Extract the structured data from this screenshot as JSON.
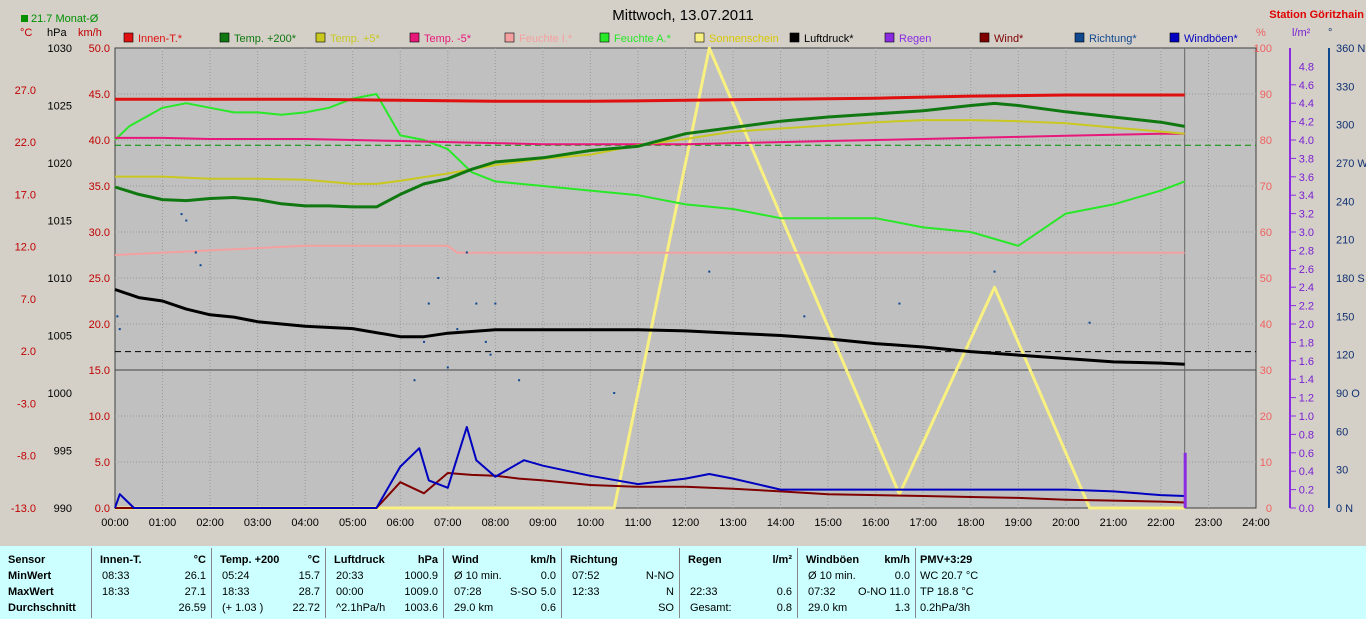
{
  "header": {
    "title": "Mittwoch, 13.07.2011",
    "station": "Station Göritzhain",
    "month_avg": "21.7 Monat-Ø",
    "unit_c": "°C",
    "unit_hpa": "hPa",
    "unit_kmh": "km/h",
    "unit_pct": "%",
    "unit_lm2": "l/m²",
    "unit_deg": "°"
  },
  "colors": {
    "innen": "#e01010",
    "t200": "#107810",
    "t5": "#c8c820",
    "tm5": "#e8187a",
    "feuchte_i": "#f4a0a0",
    "feuchte_a": "#28e828",
    "sonne": "#f8f080",
    "luftdruck": "#000000",
    "regen": "#8a2be2",
    "wind": "#800000",
    "richtung": "#104890",
    "windboeen": "#0000c0",
    "grid": "#999999"
  },
  "chart_data": {
    "type": "line",
    "x_range": [
      "00:00",
      "24:00"
    ],
    "x_ticks": [
      "00:00",
      "01:00",
      "02:00",
      "03:00",
      "04:00",
      "05:00",
      "06:00",
      "07:00",
      "08:00",
      "09:00",
      "10:00",
      "11:00",
      "12:00",
      "13:00",
      "14:00",
      "15:00",
      "16:00",
      "17:00",
      "18:00",
      "19:00",
      "20:00",
      "21:00",
      "22:00",
      "23:00",
      "24:00"
    ],
    "axes": {
      "temp_c": {
        "label": "°C",
        "ticks": [
          "27.0",
          "22.0",
          "17.0",
          "12.0",
          "7.0",
          "2.0",
          "-3.0",
          "-8.0",
          "-13.0"
        ],
        "range": [
          -13,
          31
        ]
      },
      "pressure_hpa": {
        "label": "hPa",
        "ticks": [
          "1030",
          "1025",
          "1020",
          "1015",
          "1010",
          "1005",
          "1000",
          "995",
          "990"
        ],
        "range": [
          990,
          1030
        ]
      },
      "speed_kmh": {
        "label": "km/h",
        "ticks": [
          "50.0",
          "45.0",
          "40.0",
          "35.0",
          "30.0",
          "25.0",
          "20.0",
          "15.0",
          "10.0",
          "5.0",
          "0.0"
        ],
        "range": [
          0,
          50
        ]
      },
      "humidity_pct": {
        "label": "%",
        "ticks": [
          "100",
          "90",
          "80",
          "70",
          "60",
          "50",
          "40",
          "30",
          "20",
          "10",
          "0"
        ],
        "range": [
          0,
          100
        ]
      },
      "rain_lm2": {
        "label": "l/m²",
        "ticks": [
          "4.8",
          "4.6",
          "4.4",
          "4.2",
          "4.0",
          "3.8",
          "3.6",
          "3.4",
          "3.2",
          "3.0",
          "2.8",
          "2.6",
          "2.4",
          "2.2",
          "2.0",
          "1.8",
          "1.6",
          "1.4",
          "1.2",
          "1.0",
          "0.8",
          "0.6",
          "0.4",
          "0.2",
          "0.0"
        ],
        "range": [
          0,
          5.0
        ]
      },
      "direction_deg": {
        "label": "°",
        "ticks": [
          "360 N",
          "330",
          "300",
          "270 W",
          "240",
          "210",
          "180 S",
          "150",
          "120",
          "90 O",
          "60",
          "30",
          "0 N"
        ],
        "range": [
          0,
          360
        ]
      }
    },
    "legend": [
      "Innen-T.*",
      "Temp. +200*",
      "Temp. +5*",
      "Temp. -5*",
      "Feuchte I.*",
      "Feuchte A.*",
      "Sonnenschein",
      "Luftdruck*",
      "Regen",
      "Wind*",
      "Richtung*",
      "Windböen*"
    ],
    "series": [
      {
        "name": "Innen-T.*",
        "axis": "temp_c",
        "x": [
          0,
          2,
          4,
          6,
          8,
          10,
          12,
          14,
          16,
          18,
          20,
          22.5
        ],
        "y": [
          26.1,
          26.1,
          26.1,
          26.0,
          25.9,
          25.9,
          26.0,
          26.1,
          26.2,
          26.4,
          26.5,
          26.5
        ]
      },
      {
        "name": "Temp. +200*",
        "axis": "temp_c",
        "x": [
          0,
          0.5,
          1,
          1.5,
          2,
          2.5,
          3,
          3.5,
          4,
          4.5,
          5,
          5.5,
          6,
          6.5,
          7,
          7.5,
          8,
          9,
          10,
          11,
          12,
          13,
          14,
          15,
          16,
          17,
          18,
          18.5,
          19,
          20,
          21,
          22,
          22.5
        ],
        "y": [
          17.7,
          17.0,
          16.5,
          16.4,
          16.6,
          16.7,
          16.5,
          16.1,
          15.9,
          15.9,
          15.8,
          15.8,
          17.0,
          18.0,
          18.5,
          19.4,
          20.1,
          20.5,
          21.2,
          21.6,
          22.8,
          23.4,
          24.0,
          24.4,
          24.7,
          25.0,
          25.5,
          25.7,
          25.5,
          24.9,
          24.4,
          23.9,
          23.5
        ]
      },
      {
        "name": "Temp. +5*",
        "axis": "temp_c",
        "x": [
          0,
          1,
          2,
          3,
          4,
          5,
          5.5,
          6,
          7,
          8,
          9,
          10,
          11,
          12,
          13,
          14,
          15,
          16,
          17,
          18,
          19,
          20,
          21,
          22,
          22.5
        ],
        "y": [
          18.7,
          18.7,
          18.5,
          18.5,
          18.4,
          18.0,
          18.0,
          18.3,
          19.0,
          19.8,
          20.4,
          20.8,
          21.7,
          22.3,
          23.0,
          23.3,
          23.6,
          23.9,
          24.1,
          24.1,
          24.0,
          23.8,
          23.4,
          23.0,
          22.8
        ]
      },
      {
        "name": "Temp. -5*",
        "axis": "temp_c",
        "x": [
          0,
          1,
          2,
          3,
          4,
          5,
          6,
          7,
          8,
          9,
          10,
          11,
          12,
          13,
          14,
          15,
          16,
          17,
          18,
          19,
          20,
          21,
          22,
          22.5
        ],
        "y": [
          22.4,
          22.4,
          22.3,
          22.3,
          22.3,
          22.2,
          22.1,
          22.0,
          21.9,
          21.8,
          21.8,
          21.8,
          21.8,
          21.9,
          22.0,
          22.1,
          22.2,
          22.3,
          22.4,
          22.5,
          22.6,
          22.7,
          22.8,
          22.8
        ]
      },
      {
        "name": "Feuchte I.*",
        "axis": "humidity_pct",
        "x": [
          0,
          2,
          4,
          5,
          6,
          7,
          7.2,
          8,
          10,
          12,
          14,
          16,
          18,
          20,
          22.5
        ],
        "y": [
          55,
          56,
          57,
          57,
          57,
          57,
          55.5,
          55.5,
          55.5,
          55.5,
          55.5,
          55.5,
          55.5,
          55.5,
          55.5
        ]
      },
      {
        "name": "Feuchte A.*",
        "axis": "humidity_pct",
        "x": [
          0,
          0.3,
          1,
          1.5,
          2,
          2.5,
          3,
          3.5,
          4,
          4.5,
          5,
          5.5,
          6,
          6.5,
          7,
          7.5,
          8,
          9,
          10,
          11,
          12,
          13,
          14,
          15,
          16,
          17,
          18,
          19,
          20,
          21,
          22,
          22.5
        ],
        "y": [
          80,
          83,
          87,
          88,
          87,
          86,
          86,
          85.5,
          86,
          87,
          89,
          90,
          81,
          80,
          78,
          73,
          71,
          70,
          69,
          68,
          66,
          65,
          63,
          63,
          63,
          61,
          60,
          57,
          64,
          66,
          69,
          71
        ]
      },
      {
        "name": "Sonnenschein",
        "axis": "humidity_pct",
        "x": [
          0,
          10.5,
          12.5,
          16.5,
          18.5,
          20.5,
          22.5
        ],
        "y": [
          0,
          0,
          100,
          3,
          48,
          0,
          0
        ]
      },
      {
        "name": "Luftdruck*",
        "axis": "pressure_hpa",
        "x": [
          0,
          0.5,
          1,
          1.5,
          2,
          2.5,
          3,
          4,
          5,
          6,
          6.5,
          7,
          8,
          9,
          10,
          11,
          12,
          13,
          14,
          15,
          16,
          17,
          18,
          19,
          20,
          21,
          22,
          22.5
        ],
        "y": [
          1009.0,
          1008.3,
          1008.0,
          1007.3,
          1006.8,
          1006.6,
          1006.2,
          1005.8,
          1005.6,
          1004.9,
          1004.9,
          1005.2,
          1005.5,
          1005.5,
          1005.5,
          1005.5,
          1005.4,
          1005.2,
          1005.0,
          1004.7,
          1004.3,
          1004.0,
          1003.6,
          1003.3,
          1003.0,
          1002.7,
          1002.6,
          1002.5
        ]
      },
      {
        "name": "Wind*",
        "axis": "speed_kmh",
        "x": [
          0,
          5.5,
          6,
          6.5,
          7,
          7.5,
          8,
          8.5,
          9,
          10,
          11,
          12,
          13,
          14,
          15,
          16,
          17,
          18,
          19,
          20,
          21,
          22,
          22.5
        ],
        "y": [
          0,
          0,
          2.8,
          1.6,
          3.8,
          3.6,
          3.5,
          3.2,
          3.0,
          2.5,
          2.3,
          2.3,
          2.1,
          1.8,
          1.5,
          1.4,
          1.3,
          1.2,
          1.1,
          0.9,
          0.8,
          0.7,
          0.6
        ]
      },
      {
        "name": "Windböen*",
        "axis": "speed_kmh",
        "x": [
          0,
          0.1,
          0.4,
          0.7,
          1,
          1.6,
          2,
          2.5,
          3,
          4,
          5.5,
          6,
          6.4,
          6.6,
          7,
          7.4,
          7.6,
          8,
          8.6,
          9,
          10,
          11,
          12,
          12.5,
          13,
          14,
          15,
          16,
          17,
          18,
          19,
          20,
          21,
          22,
          22.5
        ],
        "y": [
          0,
          1.5,
          0,
          0,
          0,
          0,
          0,
          0,
          0,
          0,
          0,
          4.5,
          6.5,
          3.0,
          2.2,
          8.8,
          5.2,
          3.4,
          5.2,
          4.6,
          3.5,
          2.6,
          3.2,
          3.7,
          3.2,
          2.0,
          2.0,
          2.0,
          2.0,
          2.0,
          2.0,
          2.0,
          1.8,
          1.4,
          1.3
        ]
      },
      {
        "name": "Regen",
        "axis": "rain_lm2",
        "x": [
          22.5
        ],
        "y": [
          0.6
        ]
      },
      {
        "name": "Richtung*",
        "axis": "direction_deg",
        "type": "scatter",
        "x": [
          0.05,
          0.1,
          1.4,
          1.5,
          1.7,
          1.8,
          6.3,
          6.5,
          6.6,
          6.8,
          7.0,
          7.2,
          7.4,
          7.6,
          7.8,
          7.9,
          8.0,
          8.5,
          10.5,
          12.5,
          14.5,
          16.5,
          18.5,
          20.5
        ],
        "y": [
          150,
          140,
          230,
          225,
          200,
          190,
          100,
          130,
          160,
          180,
          110,
          140,
          200,
          160,
          130,
          120,
          160,
          100,
          90,
          185,
          150,
          160,
          185,
          145
        ]
      }
    ]
  },
  "stats": {
    "sensor": {
      "title": "Sensor",
      "rows": [
        "MinWert",
        "MaxWert",
        "Durchschnitt"
      ]
    },
    "innen": {
      "title": "Innen-T.",
      "unit": "°C",
      "times": [
        "08:33",
        "18:33",
        ""
      ],
      "values": [
        "26.1",
        "27.1",
        "26.59"
      ]
    },
    "temp200": {
      "title": "Temp. +200",
      "unit": "°C",
      "times": [
        "05:24",
        "18:33",
        "(+ 1.03 )"
      ],
      "values": [
        "15.7",
        "28.7",
        "22.72"
      ]
    },
    "luftdruck": {
      "title": "Luftdruck",
      "unit": "hPa",
      "times": [
        "20:33",
        "00:00",
        "^2.1hPa/h"
      ],
      "values": [
        "1000.9",
        "1009.0",
        "1003.6"
      ]
    },
    "wind": {
      "title": "Wind",
      "unit": "km/h",
      "times": [
        "Ø 10 min.",
        "07:28",
        "29.0 km"
      ],
      "mids": [
        "",
        "S-SO",
        ""
      ],
      "values": [
        "0.0",
        "5.0",
        "0.6"
      ]
    },
    "richtung": {
      "title": "Richtung",
      "times": [
        "07:52",
        "12:33",
        ""
      ],
      "values": [
        "N-NO",
        "N",
        "SO"
      ]
    },
    "regen": {
      "title": "Regen",
      "unit": "l/m²",
      "times": [
        "",
        "22:33",
        "Gesamt:"
      ],
      "values": [
        "",
        "0.6",
        "0.8"
      ]
    },
    "windboeen": {
      "title": "Windböen",
      "unit": "km/h",
      "times": [
        "Ø 10 min.",
        "07:32",
        "29.0 km"
      ],
      "mids": [
        "",
        "O-NO",
        ""
      ],
      "values": [
        "0.0",
        "11.0",
        "1.3"
      ]
    },
    "pmv": {
      "title": "PMV+3:29",
      "lines": [
        "WC 20.7 °C",
        "TP 18.8 °C",
        "0.2hPa/3h"
      ]
    }
  }
}
